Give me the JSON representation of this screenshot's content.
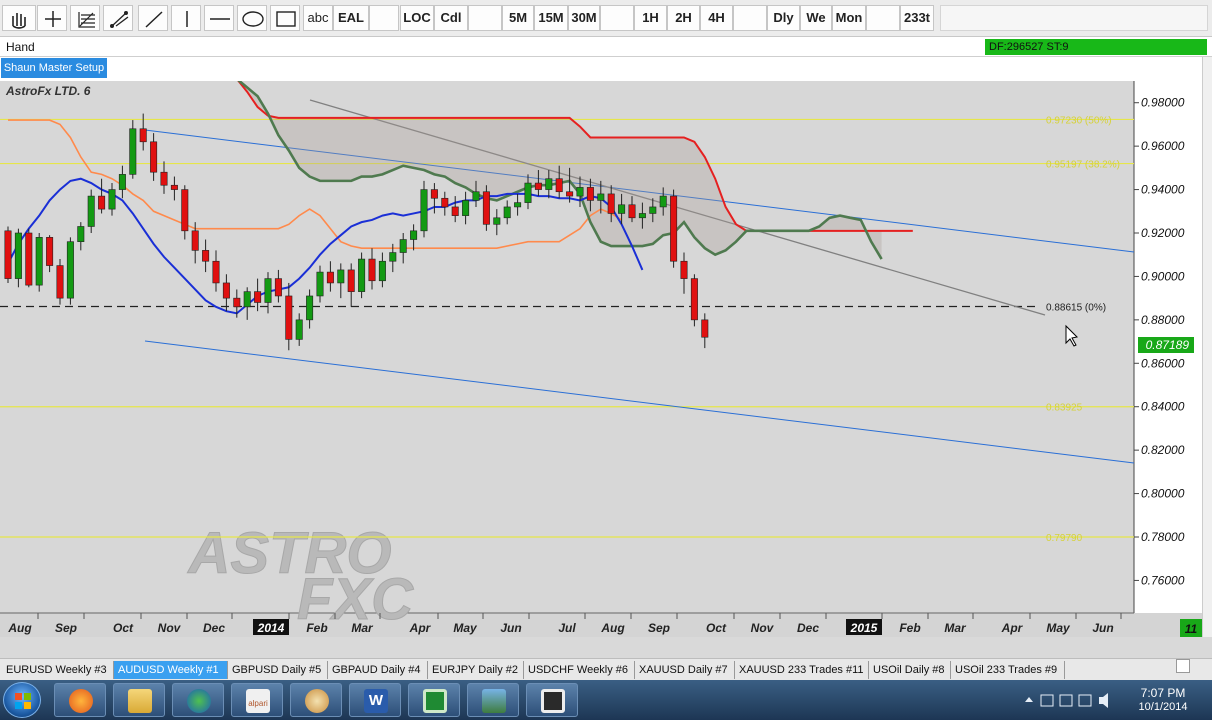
{
  "toolbar": {
    "text_tool": "abc",
    "buttons": [
      "EAL",
      "LOC",
      "Cdl",
      "5M",
      "15M",
      "30M",
      "1H",
      "2H",
      "4H",
      "Dly",
      "We",
      "Mon",
      "233t"
    ]
  },
  "status": {
    "mode": "Hand",
    "df_text": "DF:296527  ST:9"
  },
  "setup_button": "Shaun Master Setup",
  "chart": {
    "title": "AstroFx LTD. 6",
    "watermark_line1": "ASTRO",
    "watermark_line2": "FXC",
    "price_labels": [
      "0.98000",
      "0.96000",
      "0.94000",
      "0.92000",
      "0.90000",
      "0.88000",
      "0.86000",
      "0.84000",
      "0.82000",
      "0.80000",
      "0.78000",
      "0.76000"
    ],
    "current_price": "0.87189",
    "x_labels": [
      "Aug",
      "Sep",
      "Oct",
      "Nov",
      "Dec",
      "2014",
      "Feb",
      "Mar",
      "Apr",
      "May",
      "Jun",
      "Jul",
      "Aug",
      "Sep",
      "Oct",
      "Nov",
      "Dec",
      "2015",
      "Feb",
      "Mar",
      "Apr",
      "May",
      "Jun"
    ],
    "corner_label": "11",
    "fib_levels": [
      {
        "label": "0.97230  (50%)",
        "price": 0.9723
      },
      {
        "label": "0.95197  (38.2%)",
        "price": 0.95197
      },
      {
        "label": "0.88615  (0%)",
        "price": 0.88615
      },
      {
        "label": "0.83925",
        "price": 0.84
      },
      {
        "label": "0.79790",
        "price": 0.78
      }
    ],
    "colors": {
      "background": "#d7d7d7",
      "bear_candle": "#e01010",
      "bull_candle": "#139a13",
      "fast_ma": "#1a2fd6",
      "senkou_a": "#e52020",
      "senkou_b": "#4f7a4f",
      "kijun": "#ff8a4c",
      "channel": "#2a6fd6",
      "fib": "#e6e64a",
      "price_box": "#18a818"
    }
  },
  "chart_data": {
    "type": "candlestick",
    "y_range": [
      0.745,
      0.99
    ],
    "candles": [
      [
        0.921,
        0.923,
        0.897,
        0.899
      ],
      [
        0.899,
        0.922,
        0.895,
        0.92
      ],
      [
        0.92,
        0.922,
        0.895,
        0.896
      ],
      [
        0.896,
        0.92,
        0.893,
        0.918
      ],
      [
        0.918,
        0.919,
        0.902,
        0.905
      ],
      [
        0.905,
        0.908,
        0.887,
        0.89
      ],
      [
        0.89,
        0.918,
        0.887,
        0.916
      ],
      [
        0.916,
        0.925,
        0.912,
        0.923
      ],
      [
        0.923,
        0.94,
        0.92,
        0.937
      ],
      [
        0.937,
        0.945,
        0.929,
        0.931
      ],
      [
        0.931,
        0.943,
        0.928,
        0.94
      ],
      [
        0.94,
        0.951,
        0.936,
        0.947
      ],
      [
        0.947,
        0.972,
        0.945,
        0.968
      ],
      [
        0.968,
        0.975,
        0.958,
        0.962
      ],
      [
        0.962,
        0.966,
        0.944,
        0.948
      ],
      [
        0.948,
        0.953,
        0.938,
        0.942
      ],
      [
        0.942,
        0.946,
        0.935,
        0.94
      ],
      [
        0.94,
        0.942,
        0.917,
        0.921
      ],
      [
        0.921,
        0.925,
        0.906,
        0.912
      ],
      [
        0.912,
        0.917,
        0.902,
        0.907
      ],
      [
        0.907,
        0.912,
        0.893,
        0.897
      ],
      [
        0.897,
        0.901,
        0.884,
        0.89
      ],
      [
        0.89,
        0.894,
        0.881,
        0.886
      ],
      [
        0.886,
        0.895,
        0.88,
        0.893
      ],
      [
        0.893,
        0.899,
        0.884,
        0.888
      ],
      [
        0.888,
        0.902,
        0.883,
        0.899
      ],
      [
        0.899,
        0.903,
        0.888,
        0.891
      ],
      [
        0.891,
        0.897,
        0.866,
        0.871
      ],
      [
        0.871,
        0.883,
        0.868,
        0.88
      ],
      [
        0.88,
        0.894,
        0.876,
        0.891
      ],
      [
        0.891,
        0.905,
        0.888,
        0.902
      ],
      [
        0.902,
        0.907,
        0.893,
        0.897
      ],
      [
        0.897,
        0.906,
        0.89,
        0.903
      ],
      [
        0.903,
        0.906,
        0.886,
        0.893
      ],
      [
        0.893,
        0.911,
        0.89,
        0.908
      ],
      [
        0.908,
        0.913,
        0.894,
        0.898
      ],
      [
        0.898,
        0.911,
        0.895,
        0.907
      ],
      [
        0.907,
        0.915,
        0.902,
        0.911
      ],
      [
        0.911,
        0.92,
        0.906,
        0.917
      ],
      [
        0.917,
        0.924,
        0.912,
        0.921
      ],
      [
        0.921,
        0.944,
        0.918,
        0.94
      ],
      [
        0.94,
        0.943,
        0.929,
        0.936
      ],
      [
        0.936,
        0.939,
        0.928,
        0.932
      ],
      [
        0.932,
        0.937,
        0.925,
        0.928
      ],
      [
        0.928,
        0.939,
        0.924,
        0.935
      ],
      [
        0.935,
        0.944,
        0.932,
        0.939
      ],
      [
        0.939,
        0.942,
        0.921,
        0.924
      ],
      [
        0.924,
        0.931,
        0.919,
        0.927
      ],
      [
        0.927,
        0.935,
        0.924,
        0.932
      ],
      [
        0.932,
        0.938,
        0.928,
        0.934
      ],
      [
        0.934,
        0.947,
        0.931,
        0.943
      ],
      [
        0.943,
        0.949,
        0.937,
        0.94
      ],
      [
        0.94,
        0.949,
        0.936,
        0.945
      ],
      [
        0.945,
        0.951,
        0.936,
        0.939
      ],
      [
        0.939,
        0.95,
        0.934,
        0.937
      ],
      [
        0.937,
        0.946,
        0.932,
        0.941
      ],
      [
        0.941,
        0.945,
        0.93,
        0.935
      ],
      [
        0.935,
        0.944,
        0.929,
        0.938
      ],
      [
        0.938,
        0.942,
        0.925,
        0.929
      ],
      [
        0.929,
        0.938,
        0.924,
        0.933
      ],
      [
        0.933,
        0.937,
        0.925,
        0.927
      ],
      [
        0.927,
        0.934,
        0.922,
        0.929
      ],
      [
        0.929,
        0.936,
        0.925,
        0.932
      ],
      [
        0.932,
        0.941,
        0.928,
        0.937
      ],
      [
        0.937,
        0.94,
        0.904,
        0.907
      ],
      [
        0.907,
        0.911,
        0.892,
        0.899
      ],
      [
        0.899,
        0.901,
        0.877,
        0.88
      ],
      [
        0.88,
        0.883,
        0.867,
        0.872
      ]
    ],
    "series": [
      {
        "values": [
          0.906,
          0.915,
          0.922,
          0.928,
          0.935,
          0.94,
          0.944,
          0.945,
          0.943,
          0.94,
          0.938,
          0.935,
          0.929,
          0.922,
          0.915,
          0.909,
          0.904,
          0.899,
          0.894,
          0.889,
          0.886,
          0.884,
          0.883,
          0.887,
          0.891,
          0.893,
          0.894,
          0.895,
          0.899,
          0.904,
          0.91,
          0.915,
          0.919,
          0.923,
          0.925,
          0.926,
          0.928,
          0.929,
          0.928,
          0.929,
          0.93,
          0.932,
          0.932,
          0.934,
          0.935,
          0.935,
          0.937,
          0.937,
          0.938,
          0.938,
          0.938,
          0.937,
          0.937,
          0.936,
          0.936,
          0.935,
          0.937,
          0.936,
          0.932,
          0.924,
          0.914,
          0.903
        ]
      },
      {
        "values": [
          0.991,
          0.985,
          0.978,
          0.974,
          0.973,
          0.973,
          0.973,
          0.973,
          0.973,
          0.973,
          0.973,
          0.973,
          0.973,
          0.973,
          0.973,
          0.973,
          0.973,
          0.973,
          0.973,
          0.973,
          0.973,
          0.973,
          0.973,
          0.973,
          0.973,
          0.973,
          0.973,
          0.973,
          0.973,
          0.973,
          0.973,
          0.973,
          0.973,
          0.969,
          0.964,
          0.964,
          0.964,
          0.964,
          0.964,
          0.964,
          0.964,
          0.964,
          0.964,
          0.964,
          0.962,
          0.955,
          0.945,
          0.932,
          0.924,
          0.921,
          0.921,
          0.921,
          0.921,
          0.921,
          0.921,
          0.921,
          0.921,
          0.921,
          0.921,
          0.921,
          0.921,
          0.921,
          0.921,
          0.921,
          0.921,
          0.921
        ]
      },
      {
        "values": [
          0.991,
          0.987,
          0.983,
          0.975,
          0.965,
          0.958,
          0.95,
          0.946,
          0.944,
          0.944,
          0.944,
          0.944,
          0.946,
          0.946,
          0.947,
          0.949,
          0.951,
          0.95,
          0.949,
          0.947,
          0.946,
          0.943,
          0.941,
          0.938,
          0.936,
          0.935,
          0.937,
          0.939,
          0.941,
          0.942,
          0.942,
          0.943,
          0.944,
          0.938,
          0.925,
          0.916,
          0.914,
          0.914,
          0.914,
          0.914,
          0.915,
          0.919,
          0.92,
          0.925,
          0.918,
          0.913,
          0.91,
          0.912,
          0.916,
          0.921,
          0.921,
          0.921,
          0.921,
          0.921,
          0.921,
          0.921,
          0.923,
          0.927,
          0.928,
          0.927,
          0.926,
          0.916,
          0.908
        ]
      },
      {
        "values": [
          0.972,
          0.972,
          0.972,
          0.972,
          0.972,
          0.97,
          0.964,
          0.955,
          0.948,
          0.947,
          0.945,
          0.942,
          0.938,
          0.935,
          0.93,
          0.928,
          0.926,
          0.924,
          0.922,
          0.922,
          0.922,
          0.922,
          0.922,
          0.922,
          0.922,
          0.922,
          0.922,
          0.924,
          0.928,
          0.931,
          0.928,
          0.922,
          0.916,
          0.914,
          0.913,
          0.913,
          0.913,
          0.913,
          0.913,
          0.913,
          0.913,
          0.913,
          0.913,
          0.913,
          0.913,
          0.913,
          0.913,
          0.913,
          0.914,
          0.915,
          0.916,
          0.916,
          0.916,
          0.916,
          0.919,
          0.922,
          0.928,
          0.931,
          0.929,
          0.926
        ]
      }
    ]
  },
  "tabs": [
    {
      "label": "EURUSD  Weekly #3"
    },
    {
      "label": "AUDUSD  Weekly #1",
      "active": true
    },
    {
      "label": "GBPUSD  Daily #5"
    },
    {
      "label": "GBPAUD  Daily #4"
    },
    {
      "label": "EURJPY  Daily #2"
    },
    {
      "label": "USDCHF  Weekly #6"
    },
    {
      "label": "XAUUSD  Daily #7"
    },
    {
      "label": "XAUUSD  233 Trades  #11"
    },
    {
      "label": "USOil  Daily #8"
    },
    {
      "label": "USOil  233 Trades  #9"
    }
  ],
  "taskbar": {
    "apps": [
      "firefox-icon",
      "folder-icon",
      "globe-icon",
      "alpari-icon",
      "paint-icon",
      "word-icon",
      "camtasia-icon",
      "photo-icon",
      "camtasia-recorder-icon"
    ],
    "alpari_label": "alpari",
    "word_label": "W",
    "time": "7:07 PM",
    "date": "10/1/2014"
  }
}
